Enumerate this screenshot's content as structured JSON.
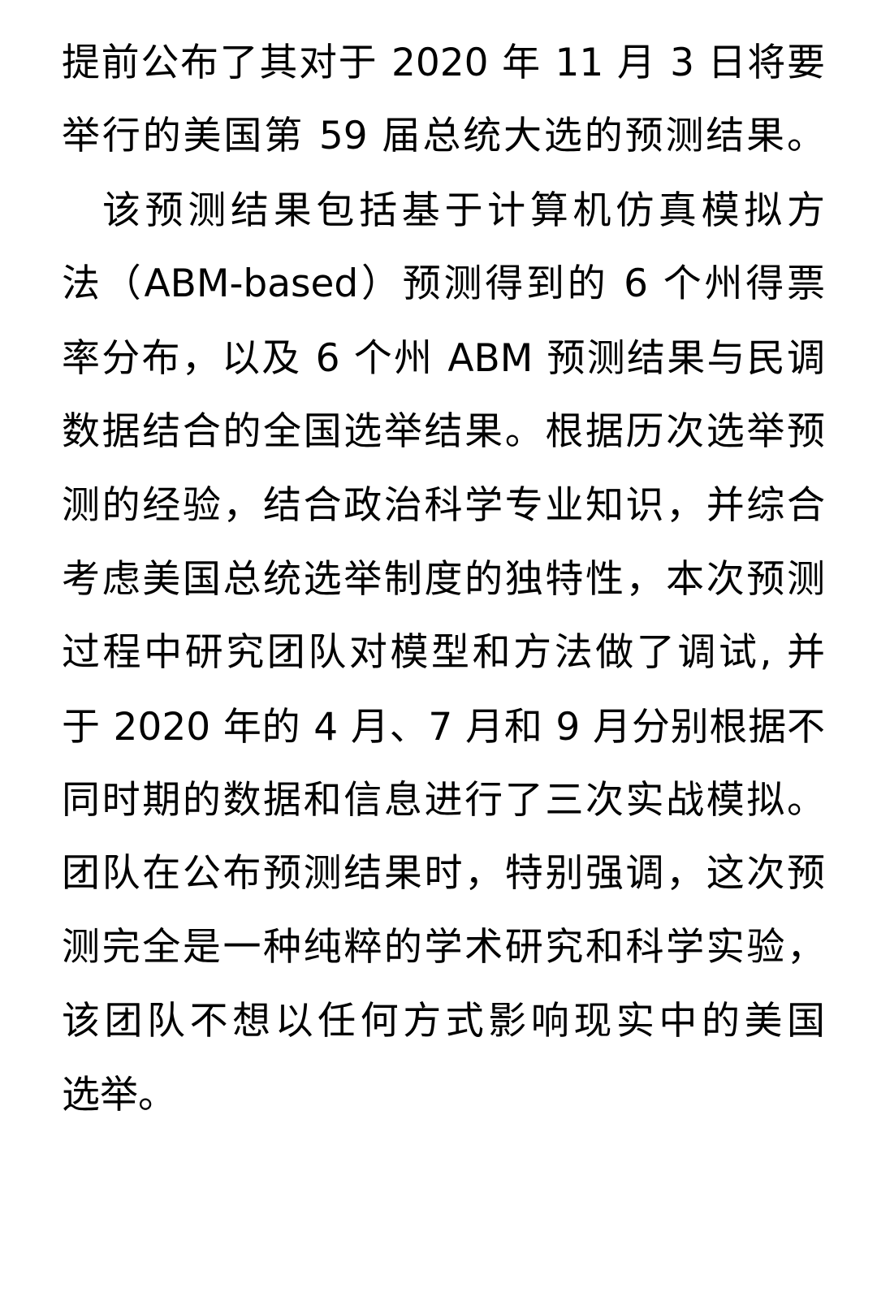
{
  "document": {
    "lines": [
      "提前公布了其对于 2020 年 11 月 3 日将要",
      "举行的美国第 59 届总统大选的预测结果。",
      "该预测结果包括基于计算机仿真模拟方",
      "法（ABM-based）预测得到的 6 个州得票",
      "率分布，以及 6 个州 ABM 预测结果与民调",
      "数据结合的全国选举结果。根据历次选举预",
      "测的经验，结合政治科学专业知识，并综合",
      "考虑美国总统选举制度的独特性，本次预测",
      "过程中研究团队对模型和方法做了调试, 并",
      "于 2020 年的 4 月、7 月和 9 月分别根据不",
      "同时期的数据和信息进行了三次实战模拟。",
      "团队在公布预测结果时，特别强调，这次预",
      "测完全是一种纯粹的学术研究和科学实验，",
      "该团队不想以任何方式影响现实中的美国",
      "选举。"
    ]
  }
}
